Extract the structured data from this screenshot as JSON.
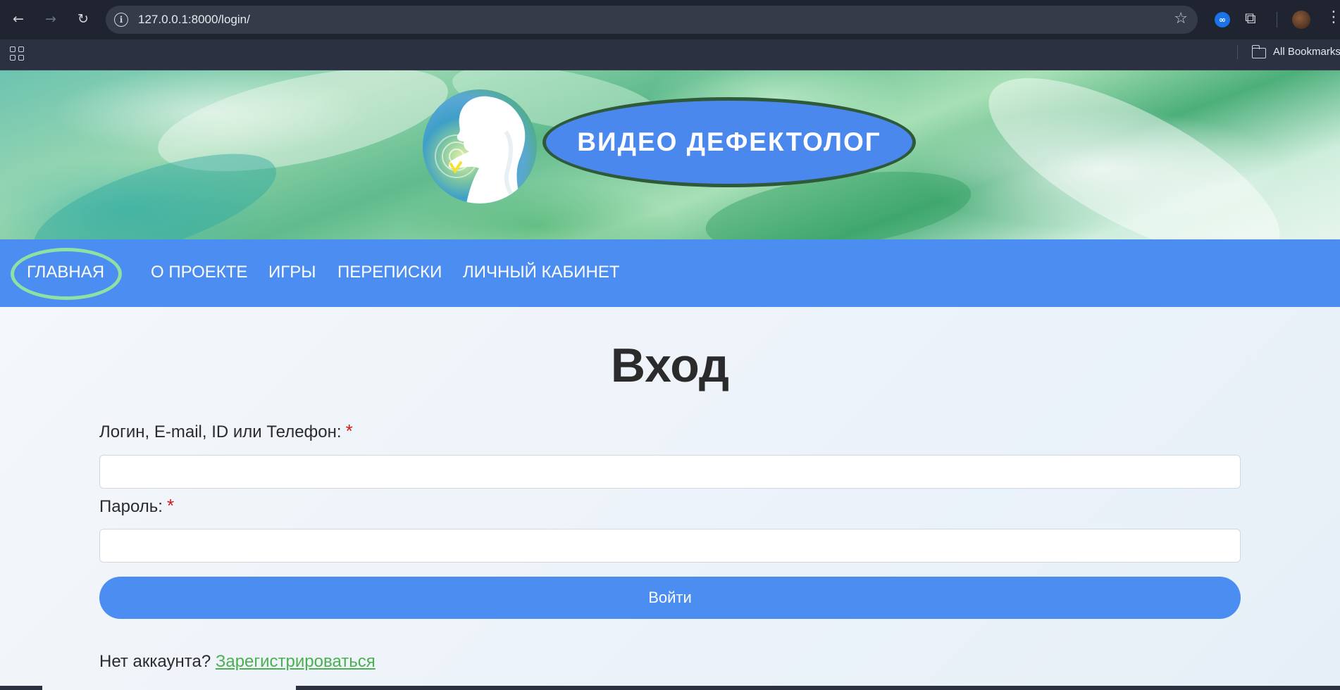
{
  "browser": {
    "url": "127.0.0.1:8000/login/",
    "extension_label": "∞",
    "bookmarks_label": "All Bookmarks",
    "icons": [
      "back-icon",
      "forward-icon",
      "reload-icon",
      "site-info-icon",
      "star-icon",
      "extension-icon",
      "puzzle-icon",
      "profile-avatar",
      "more-icon",
      "apps-icon",
      "folder-icon"
    ]
  },
  "site": {
    "title": "ВИДЕО ДЕФЕКТОЛОГ",
    "nav": [
      {
        "label": "ГЛАВНАЯ",
        "active": true
      },
      {
        "label": "О ПРОЕКТЕ"
      },
      {
        "label": "ИГРЫ"
      },
      {
        "label": "ПЕРЕПИСКИ"
      },
      {
        "label": "ЛИЧНЫЙ КАБИНЕТ"
      }
    ]
  },
  "form": {
    "heading": "Вход",
    "login_label": "Логин, E-mail, ID или Телефон:",
    "password_label": "Пароль:",
    "required_mark": "*",
    "login_value": "",
    "password_value": "",
    "submit_label": "Войти",
    "no_account_text": "Нет аккаунта?",
    "register_link": "Зарегистрироваться"
  },
  "colors": {
    "accent": "#4b8df0",
    "nav_highlight": "#8fe0a3",
    "link": "#4caf50",
    "required": "#d11a1a"
  }
}
